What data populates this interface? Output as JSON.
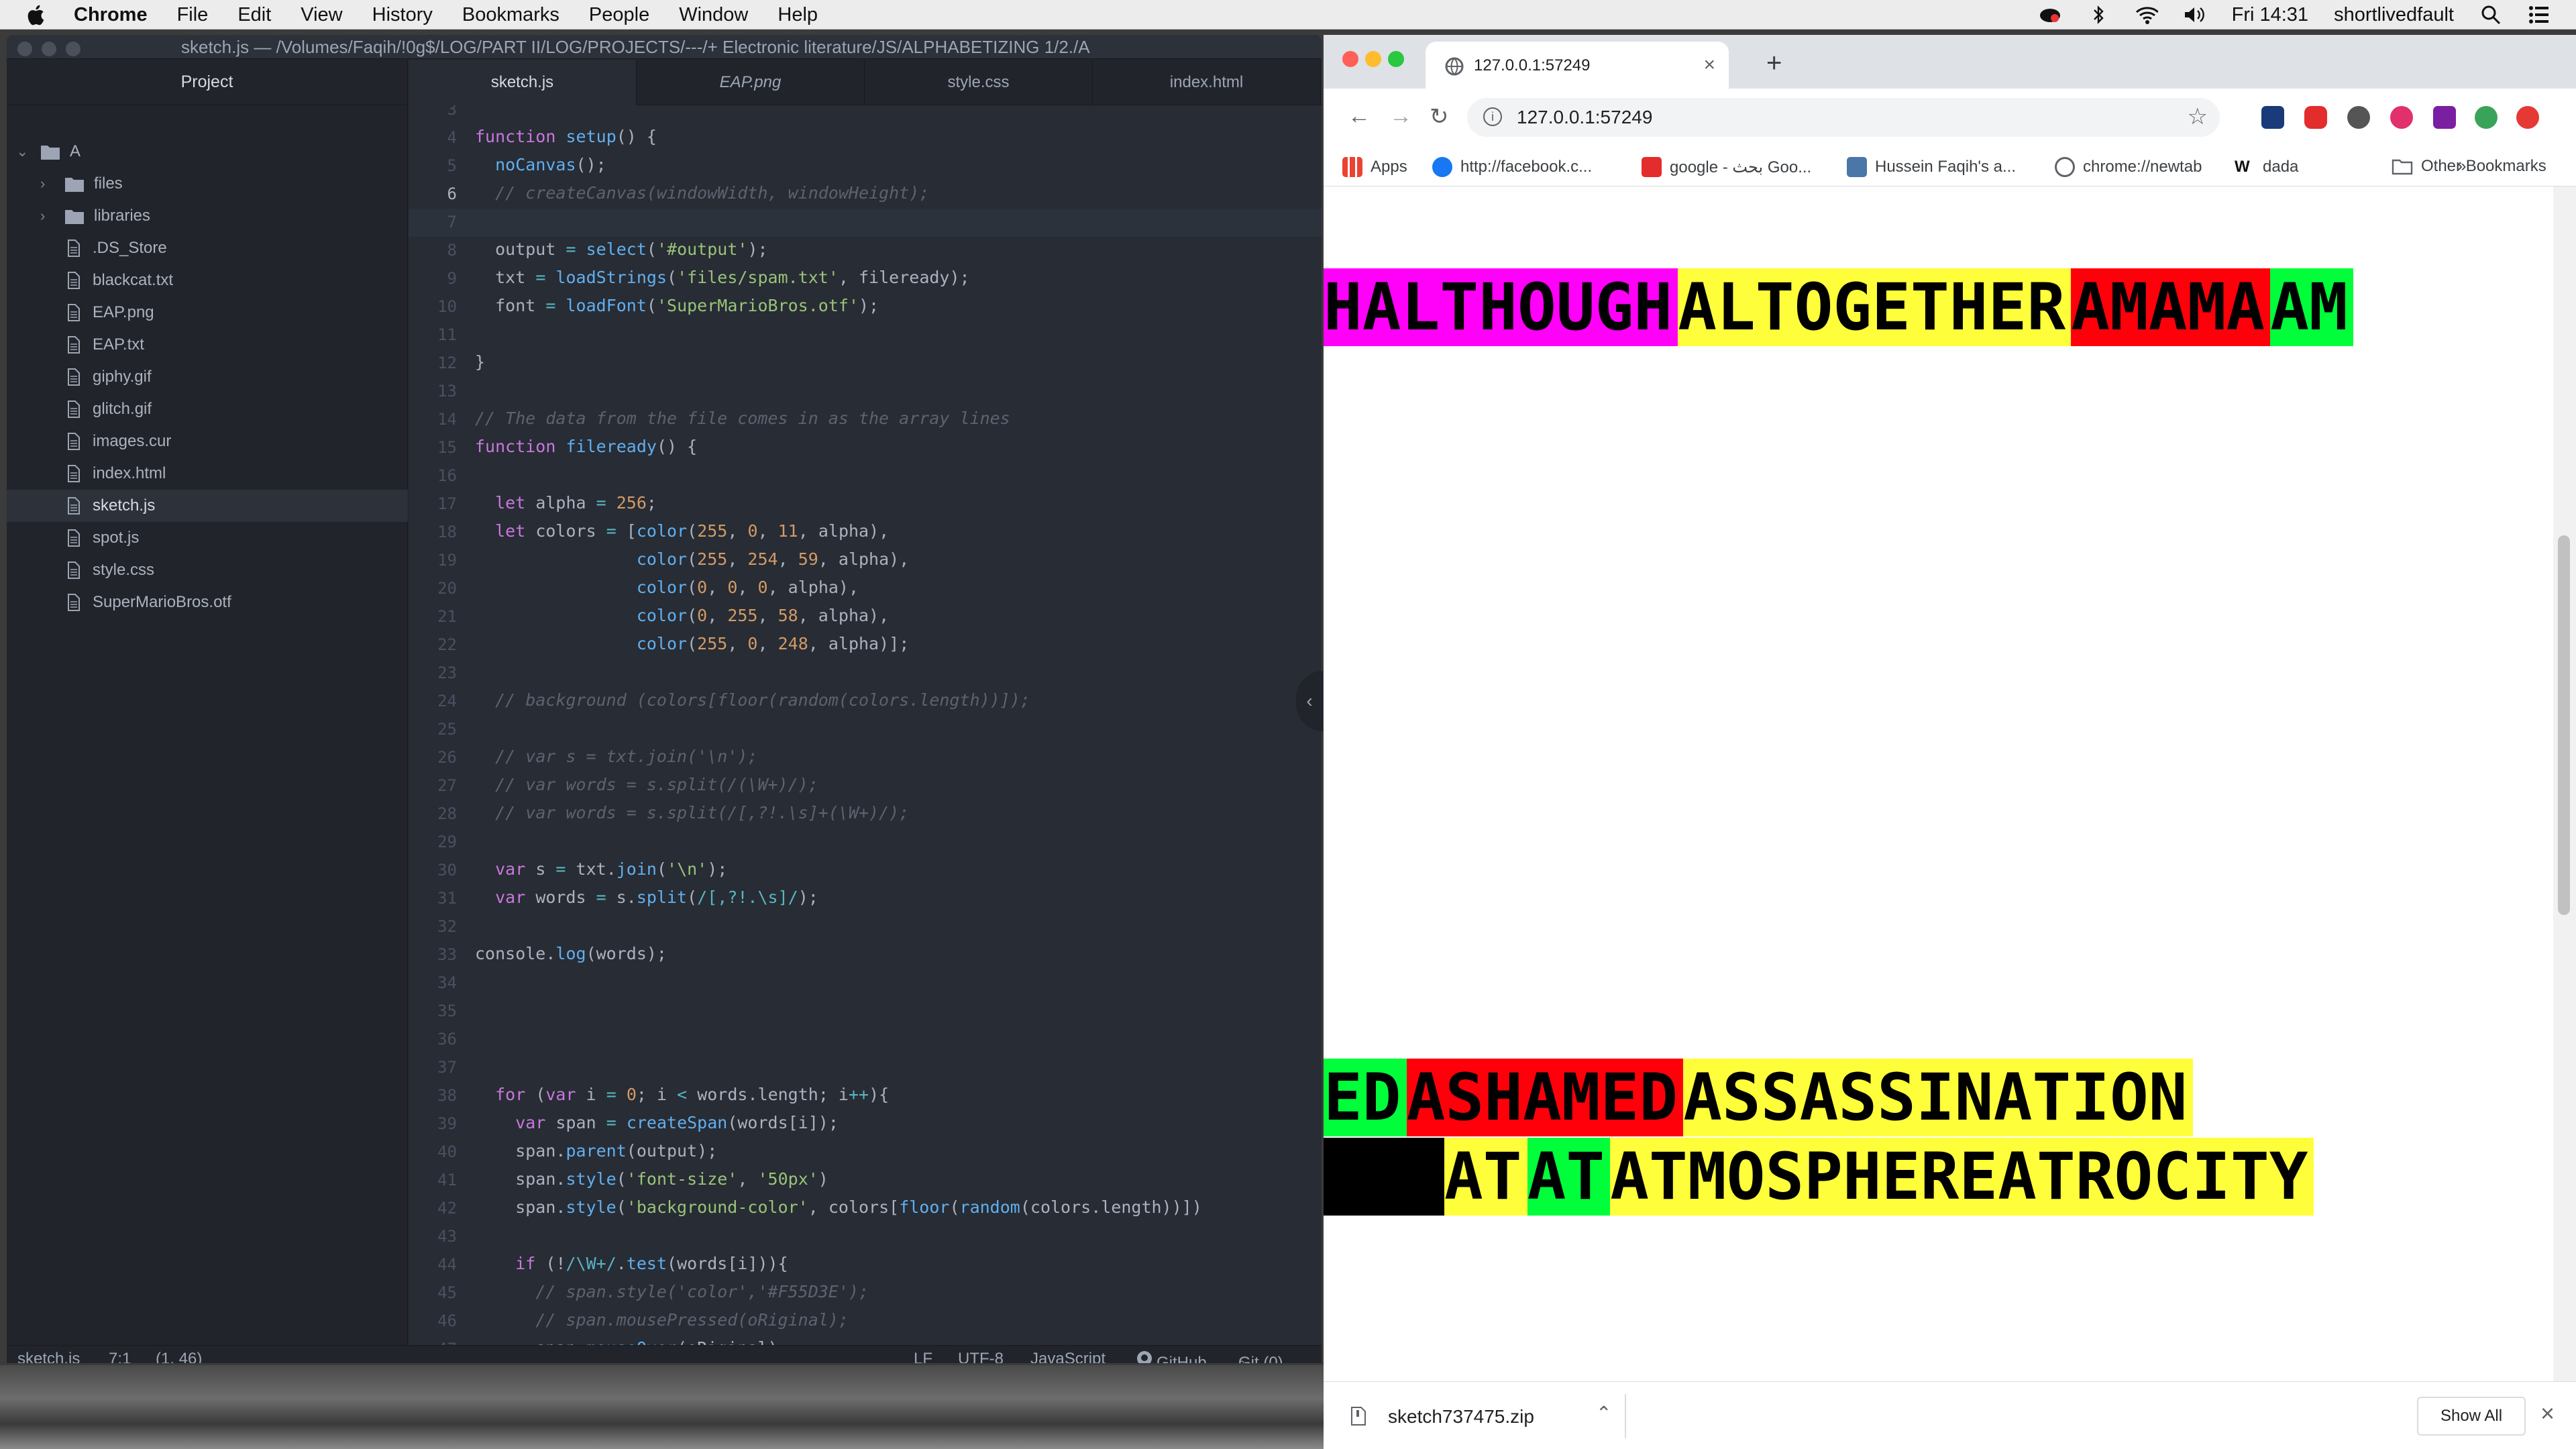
{
  "menubar": {
    "app": "Chrome",
    "items": [
      "File",
      "Edit",
      "View",
      "History",
      "Bookmarks",
      "People",
      "Window",
      "Help"
    ],
    "clock": "Fri 14:31",
    "user": "shortlivedfault"
  },
  "atom": {
    "title": "sketch.js — /Volumes/Faqih/!0g$/LOG/PART II/LOG/PROJECTS/---/+ Electronic literature/JS/ALPHABETIZING 1/2./A",
    "tree_header": "Project",
    "root": "A",
    "folders": [
      "files",
      "libraries"
    ],
    "files": [
      ".DS_Store",
      "blackcat.txt",
      "EAP.png",
      "EAP.txt",
      "giphy.gif",
      "glitch.gif",
      "images.cur",
      "index.html",
      "sketch.js",
      "spot.js",
      "style.css",
      "SuperMarioBros.otf"
    ],
    "tabs": [
      "sketch.js",
      "EAP.png",
      "style.css",
      "index.html"
    ],
    "status": {
      "file": "sketch.js",
      "pos": "7:1",
      "sel": "(1, 46)",
      "eol": "LF",
      "enc": "UTF-8",
      "grammar": "JavaScript",
      "github": "GitHub",
      "git": "Git (0)"
    }
  },
  "code": {
    "first_line": 3,
    "lines": [
      "",
      "function setup() {",
      "  noCanvas();",
      "  // createCanvas(windowWidth, windowHeight);",
      "",
      "  output = select('#output');",
      "  txt = loadStrings('files/spam.txt', fileready);",
      "  font = loadFont('SuperMarioBros.otf');",
      "",
      "}",
      "",
      "// The data from the file comes in as the array lines",
      "function fileready() {",
      "",
      "  let alpha = 256;",
      "  let colors = [color(255, 0, 11, alpha),",
      "                color(255, 254, 59, alpha),",
      "                color(0, 0, 0, alpha),",
      "                color(0, 255, 58, alpha),",
      "                color(255, 0, 248, alpha)];",
      "",
      "  // background (colors[floor(random(colors.length))]);",
      "",
      "  // var s = txt.join('\\n');",
      "  // var words = s.split(/(\\W+)/);",
      "  // var words = s.split(/[,?!.\\s]+(\\W+)/);",
      "",
      "  var s = txt.join('\\n');",
      "  var words = s.split(/[,?!.\\s]/);",
      "",
      "console.log(words);",
      "",
      "",
      "",
      "",
      "  for (var i = 0; i < words.length; i++){",
      "    var span = createSpan(words[i]);",
      "    span.parent(output);",
      "    span.style('font-size', '50px')",
      "    span.style('background-color', colors[floor(random(colors.length))])",
      "",
      "    if (!/\\W+/.test(words[i])){",
      "      // span.style('color','#F55D3E');",
      "      // span.mousePressed(oRiginal);",
      "      span.mouseOver(oRiginal);"
    ]
  },
  "browser": {
    "tab_title": "127.0.0.1:57249",
    "url": "127.0.0.1:57249",
    "bookmarks": [
      "Apps",
      "http://facebook.c...",
      "google - بحث Goo...",
      "Hussein Faqih's a...",
      "chrome://newtab",
      "dada"
    ],
    "bookmarks_more": "»",
    "other_bookmarks": "Other Bookmarks",
    "download_file": "sketch737475.zip",
    "show_all": "Show All"
  },
  "page": {
    "row1": [
      {
        "text": "HALTHOUGH",
        "color": "#ff00f8"
      },
      {
        "text": "ALTOGETHER",
        "color": "#fffe3b"
      },
      {
        "text": "AMAMA",
        "color": "#ff000b"
      },
      {
        "text": "AM",
        "color": "#00ff3a"
      }
    ],
    "row2": [
      {
        "text": "ED",
        "color": "#00ff3a"
      },
      {
        "text": "ASHAMED",
        "color": "#ff000b"
      },
      {
        "text": "ASSASSINATION",
        "color": "#fffe3b"
      }
    ],
    "row3": [
      {
        "text": "",
        "color": "#000000"
      },
      {
        "text": "AT",
        "color": "#fffe3b"
      },
      {
        "text": "AT",
        "color": "#00ff3a"
      },
      {
        "text": "ATMOSPHEREATROCITY",
        "color": "#fffe3b"
      }
    ]
  },
  "colors": {
    "mac_close": "#ff5f57",
    "mac_min": "#febc2e",
    "mac_max": "#28c840"
  }
}
